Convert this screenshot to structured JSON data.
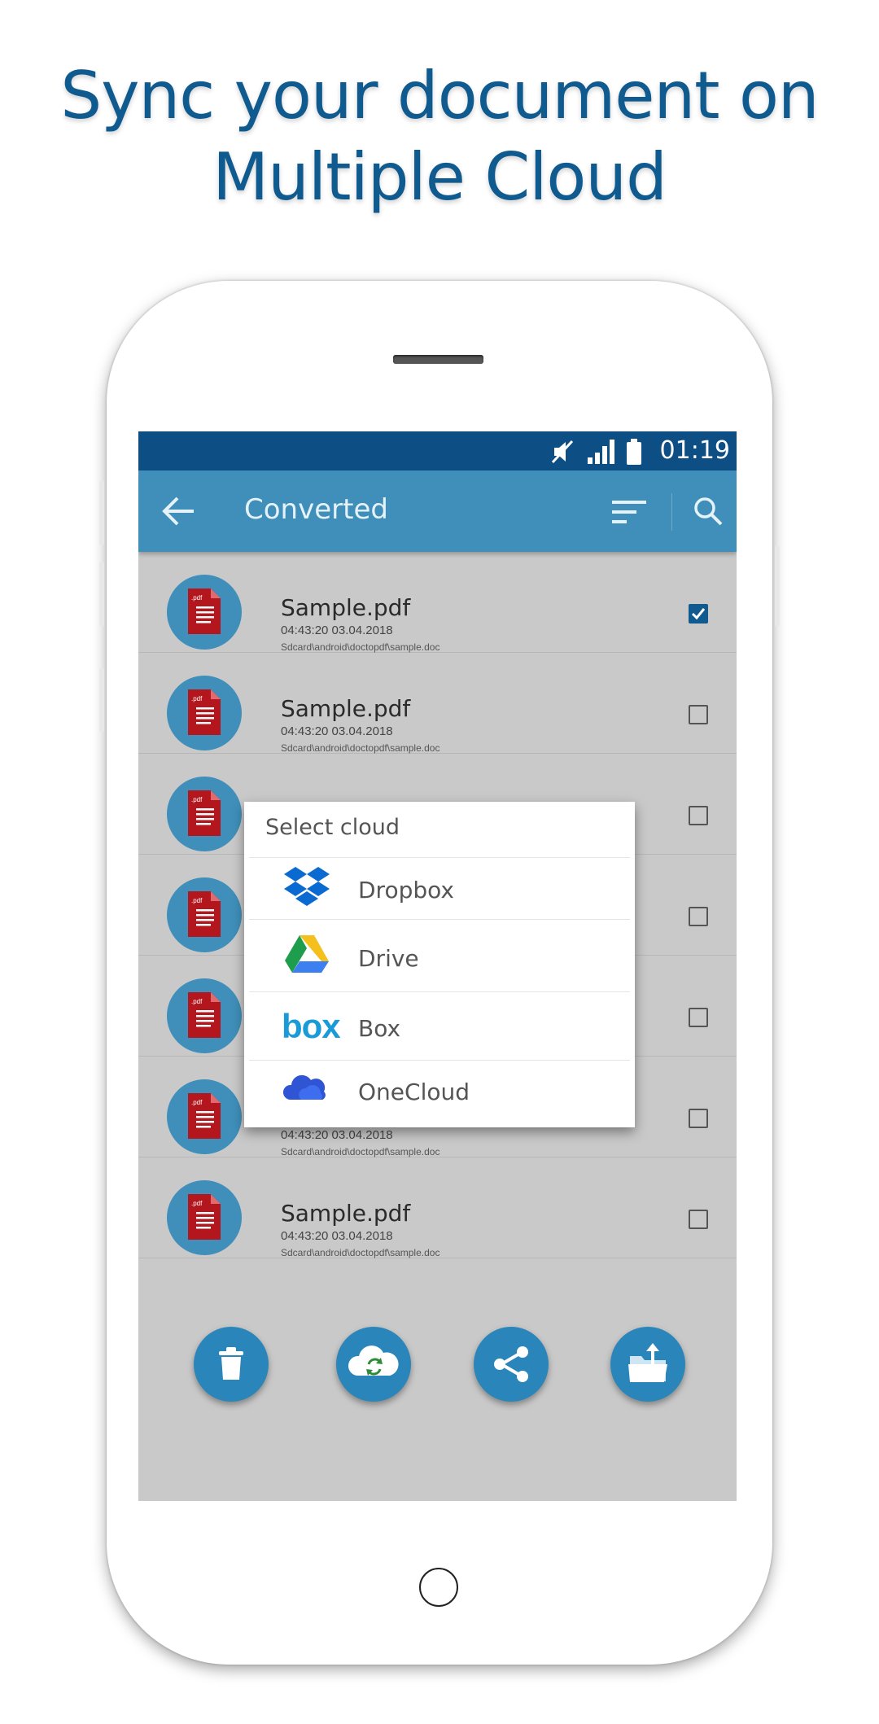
{
  "headline": {
    "line1": "Sync your document on",
    "line2": "Multiple Cloud"
  },
  "statusbar": {
    "time": "01:19",
    "icons": [
      "mute-icon",
      "signal-icon",
      "battery-icon"
    ]
  },
  "appbar": {
    "title": "Converted",
    "back_icon": "arrow-left-icon",
    "sort_icon": "sort-icon",
    "search_icon": "search-icon"
  },
  "files": [
    {
      "name": "Sample.pdf",
      "time": "04:43:20   03.04.2018",
      "path": "Sdcard\\android\\doctopdf\\sample.doc",
      "checked": true
    },
    {
      "name": "Sample.pdf",
      "time": "04:43:20   03.04.2018",
      "path": "Sdcard\\android\\doctopdf\\sample.doc",
      "checked": false
    },
    {
      "name": "",
      "time": "",
      "path": "",
      "checked": false
    },
    {
      "name": "",
      "time": "",
      "path": "",
      "checked": false
    },
    {
      "name": "",
      "time": "",
      "path": "",
      "checked": false
    },
    {
      "name": "",
      "time": "04:43:20   03.04.2018",
      "path": "Sdcard\\android\\doctopdf\\sample.doc",
      "checked": false
    },
    {
      "name": "Sample.pdf",
      "time": "04:43:20   03.04.2018",
      "path": "Sdcard\\android\\doctopdf\\sample.doc",
      "checked": false
    }
  ],
  "file_icon_label": ".pdf",
  "actions": [
    {
      "name": "delete-button",
      "icon": "trash-icon"
    },
    {
      "name": "cloud-sync-button",
      "icon": "cloud-sync-icon"
    },
    {
      "name": "share-button",
      "icon": "share-icon"
    },
    {
      "name": "move-folder-button",
      "icon": "folder-upload-icon"
    }
  ],
  "dialog": {
    "title": "Select cloud",
    "options": [
      {
        "label": "Dropbox",
        "icon": "dropbox-icon"
      },
      {
        "label": "Drive",
        "icon": "google-drive-icon"
      },
      {
        "label": "Box",
        "icon": "box-logo-icon",
        "logo_text": "box"
      },
      {
        "label": "OneCloud",
        "icon": "onedrive-cloud-icon"
      }
    ]
  },
  "colors": {
    "headline": "#0f5a8f",
    "statusbar": "#0d4f84",
    "appbar": "#3f8fba",
    "fab": "#2a86ba",
    "pdf_icon": "#b3161c",
    "overlay_bg": "#c9c9c9"
  }
}
